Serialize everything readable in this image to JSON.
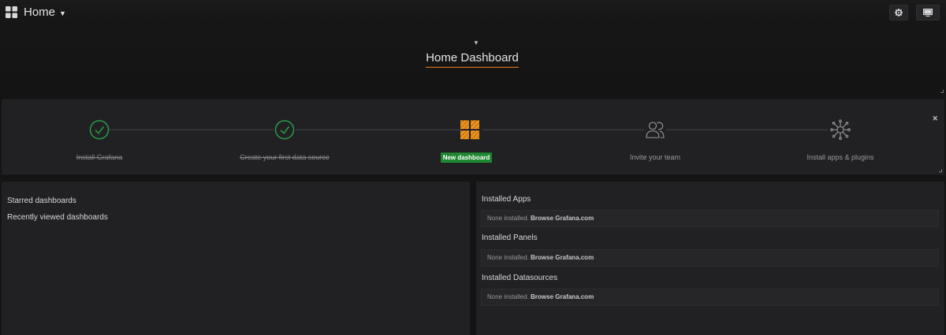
{
  "navbar": {
    "title": "Home"
  },
  "dashboard": {
    "title": "Home Dashboard"
  },
  "steps": [
    {
      "label": "Install Grafana",
      "status": "done",
      "icon": "checkmark-icon"
    },
    {
      "label": "Create your first data source",
      "status": "done",
      "icon": "checkmark-icon"
    },
    {
      "label": "New dashboard",
      "status": "active",
      "icon": "dashboard-grid-icon"
    },
    {
      "label": "Invite your team",
      "status": "todo",
      "icon": "users-icon"
    },
    {
      "label": "Install apps & plugins",
      "status": "todo",
      "icon": "plugins-icon"
    }
  ],
  "close_label": "×",
  "left_panel": {
    "starred": "Starred dashboards",
    "recent": "Recently viewed dashboards"
  },
  "right_panel": {
    "sections": [
      {
        "title": "Installed Apps",
        "none_text": "None installed.",
        "link": "Browse Grafana.com"
      },
      {
        "title": "Installed Panels",
        "none_text": "None installed.",
        "link": "Browse Grafana.com"
      },
      {
        "title": "Installed Datasources",
        "none_text": "None installed.",
        "link": "Browse Grafana.com"
      }
    ]
  },
  "colors": {
    "accent": "#eb7b18",
    "success": "#1f8730",
    "check": "#299c46",
    "panel": "#212124",
    "background": "#141414"
  }
}
